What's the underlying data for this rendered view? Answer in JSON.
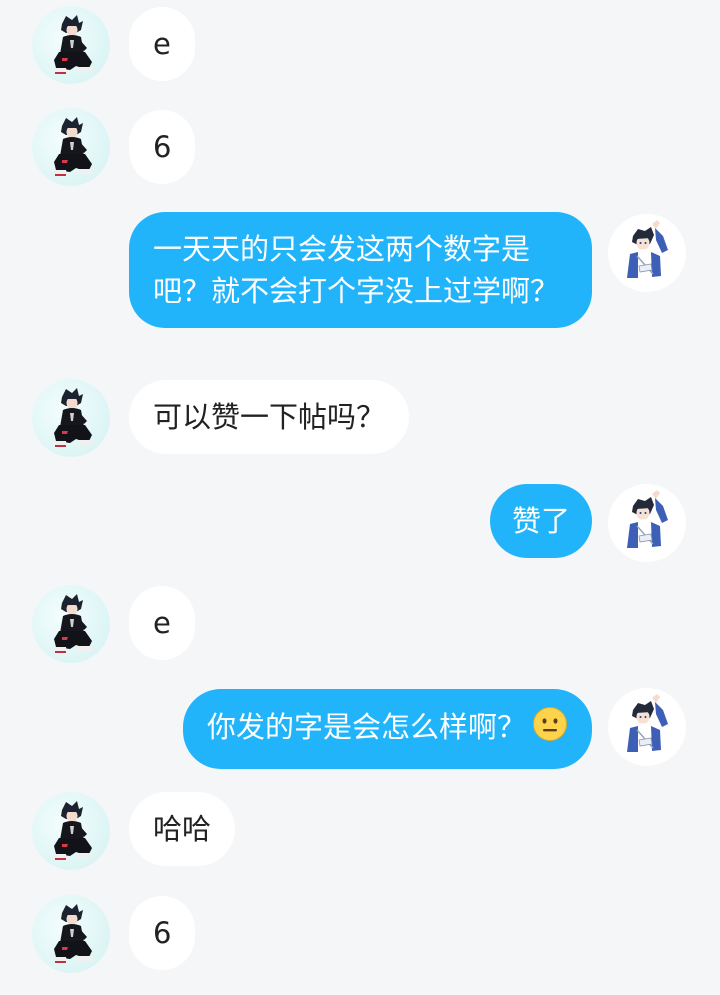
{
  "conversation": {
    "messages": [
      {
        "side": "left",
        "text": "e",
        "avatar_icon": "anime-boy-dark-outfit-avatar"
      },
      {
        "side": "left",
        "text": "6",
        "avatar_icon": "anime-boy-dark-outfit-avatar"
      },
      {
        "side": "right",
        "text": "一天天的只会发这两个数字是吧？就不会打个字没上过学啊？",
        "avatar_icon": "anime-boy-blue-jacket-avatar"
      },
      {
        "side": "left",
        "text": "可以赞一下帖吗？",
        "avatar_icon": "anime-boy-dark-outfit-avatar"
      },
      {
        "side": "right",
        "text": "赞了",
        "avatar_icon": "anime-boy-blue-jacket-avatar"
      },
      {
        "side": "left",
        "text": "e",
        "avatar_icon": "anime-boy-dark-outfit-avatar"
      },
      {
        "side": "right",
        "text": "你发的字是会怎么样啊？",
        "emoji": "neutral-face-emoji",
        "avatar_icon": "anime-boy-blue-jacket-avatar"
      },
      {
        "side": "left",
        "text": "哈哈",
        "avatar_icon": "anime-boy-dark-outfit-avatar"
      },
      {
        "side": "left",
        "text": "6",
        "avatar_icon": "anime-boy-dark-outfit-avatar"
      }
    ]
  },
  "colors": {
    "background": "#f5f6f8",
    "incoming_bubble": "#ffffff",
    "outgoing_bubble": "#21b4fb",
    "incoming_text": "#222222",
    "outgoing_text": "#ffffff"
  }
}
